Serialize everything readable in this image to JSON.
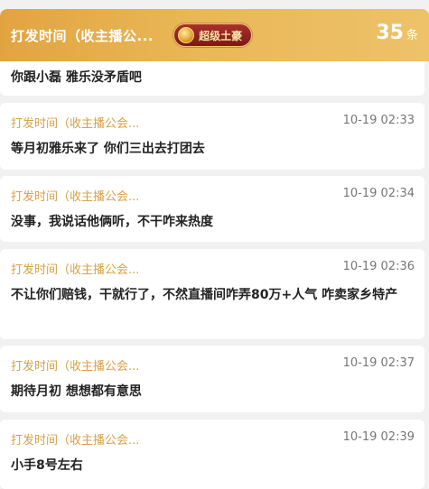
{
  "header": {
    "name": "打发时间（收主播公...",
    "badge": "超级土豪",
    "count": "35",
    "count_unit": "条"
  },
  "messages": [
    {
      "user": "",
      "time": "",
      "text": "你跟小磊 雅乐没矛盾吧"
    },
    {
      "user": "打发时间（收主播公会...",
      "time": "10-19 02:33",
      "text": "等月初雅乐来了 你们三出去打团去"
    },
    {
      "user": "打发时间（收主播公会...",
      "time": "10-19 02:34",
      "text": "没事，我说话他俩听，不干咋来热度"
    },
    {
      "user": "打发时间（收主播公会...",
      "time": "10-19 02:36",
      "text": "不让你们赔钱，干就行了，不然直播间咋弄80万+人气 咋卖家乡特产"
    },
    {
      "user": "打发时间（收主播公会...",
      "time": "10-19 02:37",
      "text": "期待月初 想想都有意思"
    },
    {
      "user": "打发时间（收主播公会...",
      "time": "10-19 02:39",
      "text": "小手8号左右"
    }
  ]
}
